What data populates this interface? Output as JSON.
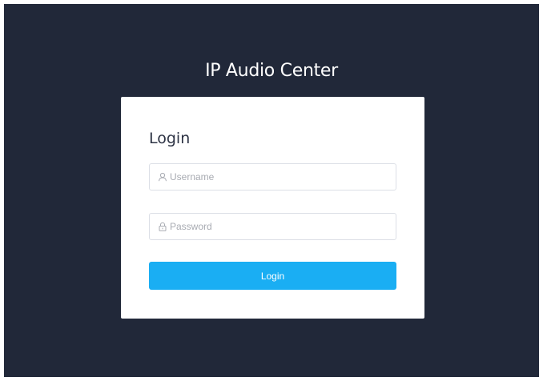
{
  "app": {
    "title": "IP Audio Center"
  },
  "login_card": {
    "heading": "Login",
    "username": {
      "placeholder": "Username",
      "value": "",
      "icon": "user-icon"
    },
    "password": {
      "placeholder": "Password",
      "value": "",
      "icon": "lock-icon"
    },
    "submit_label": "Login"
  },
  "colors": {
    "background": "#212839",
    "card": "#ffffff",
    "accent": "#1aaef3",
    "input_border": "#dcdfe6",
    "placeholder": "#a8abb2"
  }
}
